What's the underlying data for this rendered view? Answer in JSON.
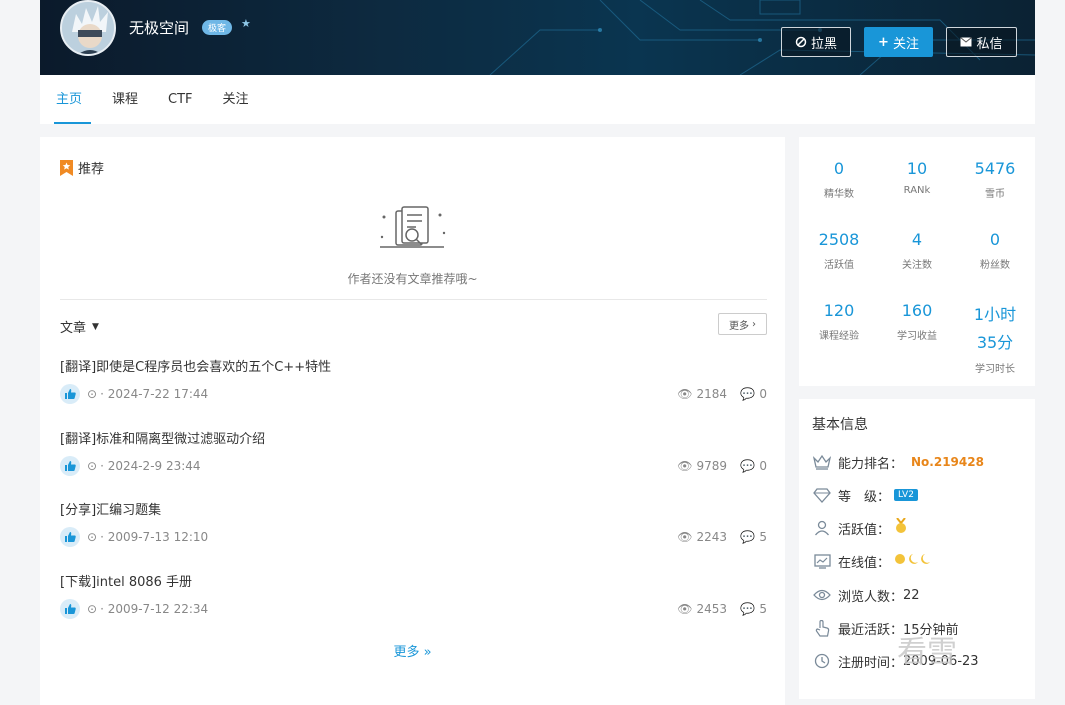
{
  "header": {
    "username": "无极空间",
    "badge": "极客",
    "buttons": {
      "block": "拉黑",
      "follow": "关注",
      "message": "私信"
    },
    "colors": {
      "accent": "#1996d8",
      "banner": "#0b1a2b"
    }
  },
  "tabs": [
    {
      "label": "主页",
      "active": true
    },
    {
      "label": "课程",
      "active": false
    },
    {
      "label": "CTF",
      "active": false
    },
    {
      "label": "关注",
      "active": false
    }
  ],
  "recommend": {
    "title": "推荐",
    "empty_text": "作者还没有文章推荐哦~"
  },
  "articles": {
    "title": "文章",
    "more_button": "更多",
    "more_link": "更多 »",
    "items": [
      {
        "title": "[翻译]即使是C程序员也会喜欢的五个C++特性",
        "date": "· 2024-7-22 17:44",
        "views": "2184",
        "comments": "0"
      },
      {
        "title": "[翻译]标准和隔离型微过滤驱动介绍",
        "date": "· 2024-2-9 23:44",
        "views": "9789",
        "comments": "0"
      },
      {
        "title": "[分享]汇编习题集",
        "date": "· 2009-7-13 12:10",
        "views": "2243",
        "comments": "5"
      },
      {
        "title": "[下载]intel 8086 手册",
        "date": "· 2009-7-12 22:34",
        "views": "2453",
        "comments": "5"
      }
    ]
  },
  "stats": [
    {
      "value": "0",
      "label": "精华数"
    },
    {
      "value": "10",
      "label": "RANk"
    },
    {
      "value": "5476",
      "label": "雪币"
    },
    {
      "value": "2508",
      "label": "活跃值"
    },
    {
      "value": "4",
      "label": "关注数"
    },
    {
      "value": "0",
      "label": "粉丝数"
    },
    {
      "value": "120",
      "label": "课程经验"
    },
    {
      "value": "160",
      "label": "学习收益"
    },
    {
      "value": "1小时35分",
      "value_line1": "1小时",
      "value_line2": "35分",
      "label": "学习时长"
    }
  ],
  "info": {
    "title": "基本信息",
    "rank_label": "能力排名：",
    "rank_value": "No.219428",
    "level_label": "等　级：",
    "level_value": "LV2",
    "activity_label": "活跃值：",
    "online_label": "在线值：",
    "views_label": "浏览人数：",
    "views_value": "22",
    "last_active_label": "最近活跃：",
    "last_active_value": "15分钟前",
    "register_label": "注册时间：",
    "register_value": "2009-06-23"
  },
  "watermark": "看雪"
}
